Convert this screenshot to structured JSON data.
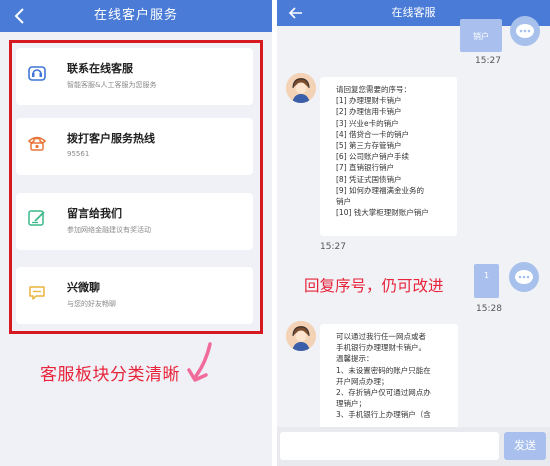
{
  "left": {
    "header": {
      "back_glyph": "‹",
      "title": "在线客户服务"
    },
    "cards": [
      {
        "icon": "headset-icon",
        "title": "联系在线客服",
        "subtitle": "智能客服&人工客服为您服务"
      },
      {
        "icon": "telephone-icon",
        "title": "拨打客户服务热线",
        "subtitle": "95561"
      },
      {
        "icon": "edit-message-icon",
        "title": "留言给我们",
        "subtitle": "参加网络金融建议有奖活动"
      },
      {
        "icon": "chat-bubble-icon",
        "title": "兴微聊",
        "subtitle": "与您的好友畅聊"
      }
    ],
    "caption": "客服板块分类清晰",
    "colors": {
      "header": "#4a7bd6",
      "highlight_border": "#d61921",
      "caption": "#e8233a",
      "arrow": "#f06a9a"
    }
  },
  "right": {
    "header": {
      "back_glyph": "←",
      "title": "在线客服"
    },
    "user_message_1": "销户",
    "time_1": "15:27",
    "cs_message_1": [
      "请回复您需要的序号：",
      "[1] 办理理财卡销户",
      "[2] 办理信用卡销户",
      "[3] 兴业e卡的销户",
      "[4] 借贷合一卡的销户",
      "[5] 第三方存管销户",
      "[6] 公司账户销户手续",
      "[7] 直销银行销户",
      "[8] 凭证式国债销户",
      "[9] 如何办理福满金业务的",
      "销户",
      "[10] 钱大掌柜理财账户销户"
    ],
    "time_2": "15:27",
    "caption": "回复序号，仍可改进",
    "user_message_2": "1",
    "time_3": "15:28",
    "cs_message_2": [
      "可以通过我行任一网点或者",
      "手机银行办理理财卡销户。",
      "温馨提示：",
      "1、未设置密码的账户只能在",
      "开户网点办理；",
      "2、存折销户仅可通过网点办",
      "理销户；",
      "3、手机银行上办理销户（含"
    ],
    "send_label": "发送",
    "colors": {
      "header": "#4a7bd6",
      "user_bubble": "#a9c0ee",
      "send_button": "#a9c0ee"
    }
  }
}
